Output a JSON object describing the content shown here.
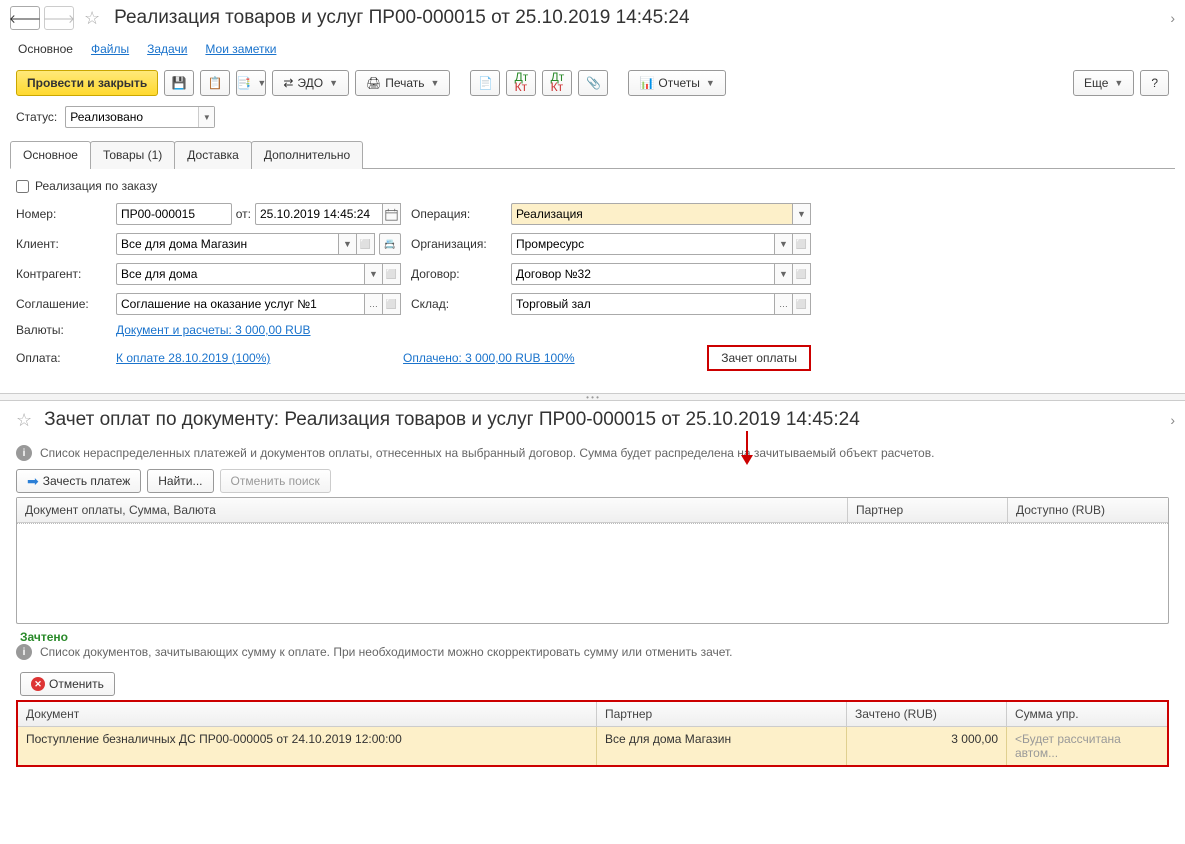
{
  "header": {
    "title": "Реализация товаров и услуг ПР00-000015 от 25.10.2019 14:45:24"
  },
  "nav_tabs": {
    "main": "Основное",
    "files": "Файлы",
    "tasks": "Задачи",
    "notes": "Мои заметки"
  },
  "toolbar": {
    "post_close": "Провести и закрыть",
    "edo": "ЭДО",
    "print": "Печать",
    "reports": "Отчеты",
    "more": "Еще",
    "help": "?"
  },
  "status": {
    "label": "Статус:",
    "value": "Реализовано"
  },
  "form_tabs": [
    "Основное",
    "Товары (1)",
    "Доставка",
    "Дополнительно"
  ],
  "form": {
    "by_order_label": "Реализация по заказу",
    "labels": {
      "number": "Номер:",
      "from": "от:",
      "client": "Клиент:",
      "contragent": "Контрагент:",
      "agreement": "Соглашение:",
      "currency": "Валюты:",
      "payment": "Оплата:",
      "operation": "Операция:",
      "organization": "Организация:",
      "dogovor": "Договор:",
      "warehouse": "Склад:"
    },
    "values": {
      "number": "ПР00-000015",
      "date": "25.10.2019 14:45:24",
      "client": "Все для дома Магазин",
      "contragent": "Все для дома",
      "agreement": "Соглашение на оказание услуг №1",
      "operation": "Реализация",
      "organization": "Промресурс",
      "dogovor": "Договор №32",
      "warehouse": "Торговый зал"
    },
    "currency_link": "Документ и расчеты: 3 000,00 RUB",
    "payment_link": "К оплате 28.10.2019 (100%)",
    "paid_link": "Оплачено: 3 000,00 RUB  100%",
    "offset_btn": "Зачет оплаты"
  },
  "lower": {
    "title": "Зачет оплат по документу: Реализация товаров и услуг ПР00-000015 от 25.10.2019 14:45:24",
    "info1": "Список нераспределенных платежей и документов оплаты, отнесенных на выбранный договор. Сумма будет распределена на зачитываемый объект расчетов.",
    "offset_payment": "Зачесть платеж",
    "find": "Найти...",
    "cancel_search": "Отменить поиск",
    "table1": {
      "col1": "Документ оплаты, Сумма, Валюта",
      "col2": "Партнер",
      "col3": "Доступно (RUB)"
    },
    "green_label": "Зачтено",
    "info2": "Список документов, зачитывающих сумму к оплате. При необходимости можно скорректировать сумму или отменить зачет.",
    "cancel": "Отменить",
    "table2": {
      "col1": "Документ",
      "col2": "Партнер",
      "col3": "Зачтено (RUB)",
      "col4": "Сумма упр."
    },
    "row": {
      "doc": "Поступление безналичных ДС ПР00-000005 от 24.10.2019 12:00:00",
      "partner": "Все для дома Магазин",
      "amount": "3 000,00",
      "sum": "<Будет рассчитана автом..."
    }
  }
}
